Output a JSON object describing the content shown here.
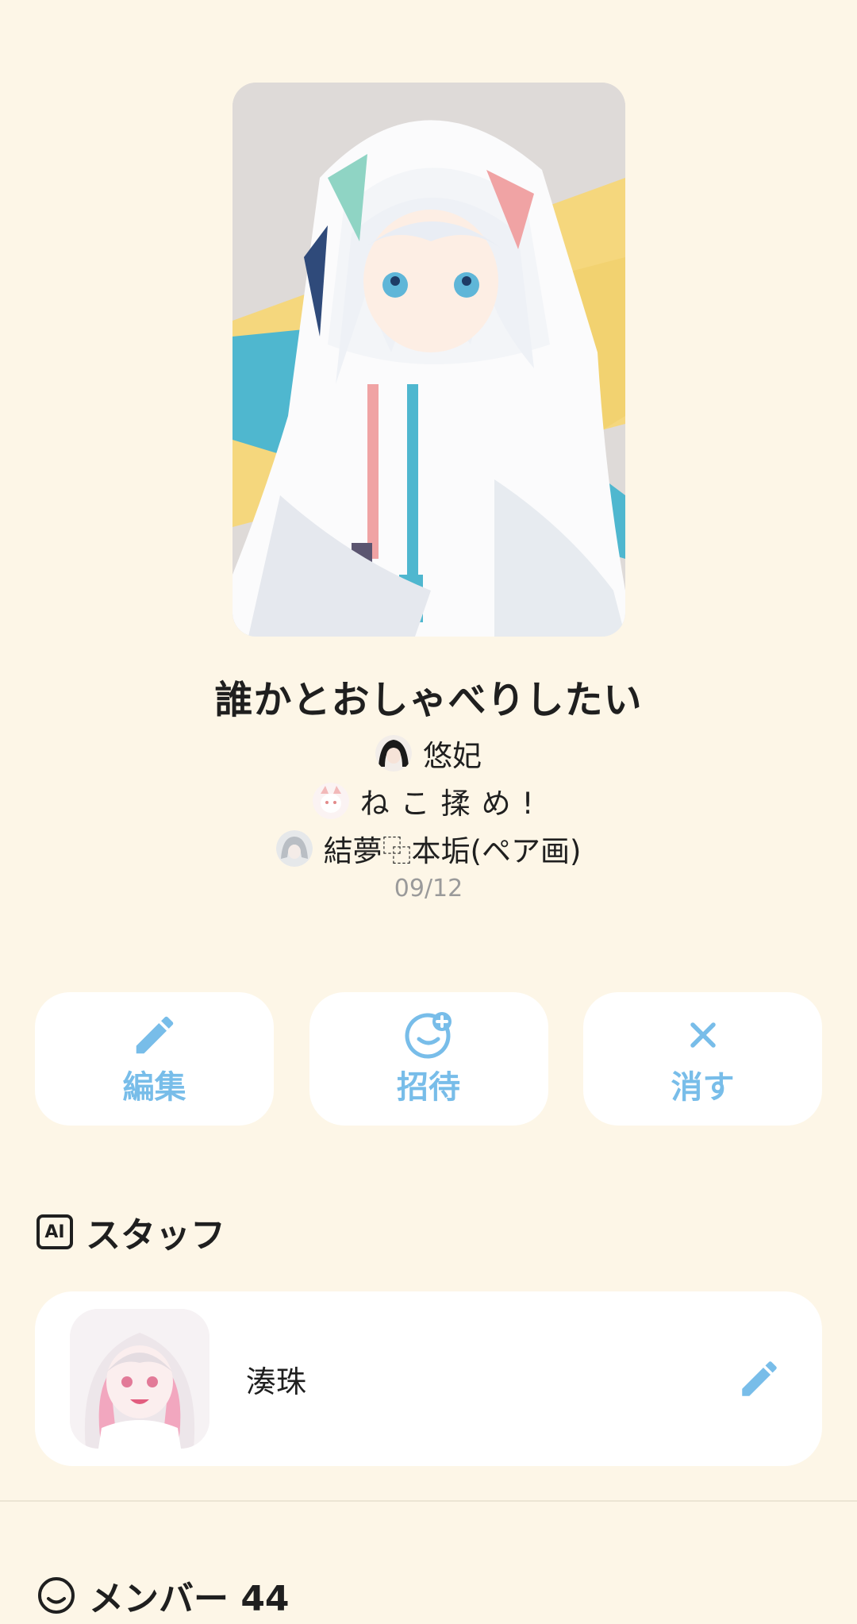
{
  "room": {
    "title": "誰かとおしゃべりしたい",
    "creators": [
      {
        "name": "悠妃",
        "avatar_icon": "avatar-dark-hair"
      },
      {
        "name": "ねこ揉め!",
        "avatar_icon": "avatar-cat-ears"
      },
      {
        "name": "結夢⿻本垢(ペア画)",
        "avatar_icon": "avatar-silver-hair"
      }
    ],
    "date": "09/12"
  },
  "actions": {
    "edit_label": "編集",
    "invite_label": "招待",
    "delete_label": "消す"
  },
  "staff": {
    "heading": "スタッフ",
    "ai_badge": "AI",
    "members": [
      {
        "name": "湊珠"
      }
    ]
  },
  "members": {
    "heading": "メンバー 44"
  },
  "colors": {
    "background": "#fdf6e7",
    "card": "#ffffff",
    "accent": "#78bde9",
    "muted_text": "#9a9a9a"
  }
}
